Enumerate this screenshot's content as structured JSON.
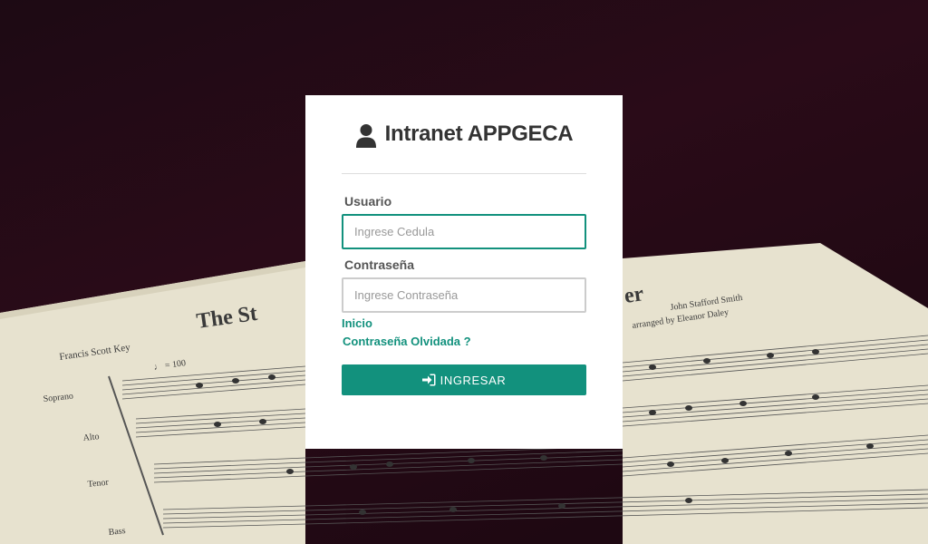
{
  "login": {
    "title": "Intranet APPGECA",
    "user_label": "Usuario",
    "user_placeholder": "Ingrese Cedula",
    "password_label": "Contraseña",
    "password_placeholder": "Ingrese Contraseña",
    "home_link": "Inicio",
    "forgot_link": "Contraseña Olvidada ?",
    "submit_label": "INGRESAR"
  },
  "sheet_music": {
    "title": "The St",
    "title_end": "er",
    "composer": "Francis Scott Key",
    "arranger_1": "John Stafford Smith",
    "arranger_2": "arranged by Eleanor Daley",
    "tempo": "♩ = 100",
    "voices": [
      "Soprano",
      "Alto",
      "Tenor",
      "Bass"
    ]
  },
  "colors": {
    "accent": "#12917d",
    "background": "#2a0b18",
    "card": "#ffffff"
  }
}
